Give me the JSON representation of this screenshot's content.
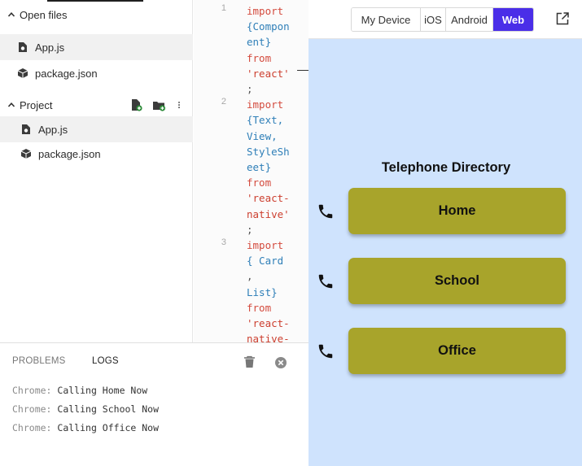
{
  "sidebar": {
    "open_files_label": "Open files",
    "open_files": [
      {
        "name": "App.js",
        "icon": "react-file-icon",
        "active": true
      },
      {
        "name": "package.json",
        "icon": "package-icon",
        "active": false
      }
    ],
    "project_label": "Project",
    "project_files": [
      {
        "name": "App.js",
        "icon": "react-file-icon",
        "active": true
      },
      {
        "name": "package.json",
        "icon": "package-icon",
        "active": false
      }
    ],
    "project_actions": [
      "new-file-icon",
      "new-folder-icon",
      "more-vertical-icon"
    ]
  },
  "editor": {
    "line_numbers": [
      "1",
      "2",
      "3"
    ],
    "lines": [
      {
        "text": "import",
        "cls": "kw"
      },
      {
        "text": "{Compon",
        "cls": "id"
      },
      {
        "text": "ent}",
        "cls": "id"
      },
      {
        "text": "from",
        "cls": "kw"
      },
      {
        "text": "'react'",
        "cls": "str"
      },
      {
        "text": ";",
        "cls": "pn"
      },
      {
        "text": "import",
        "cls": "kw"
      },
      {
        "text": "{Text,",
        "cls": "id"
      },
      {
        "text": "View,",
        "cls": "id"
      },
      {
        "text": "StyleSh",
        "cls": "id"
      },
      {
        "text": "eet}",
        "cls": "id"
      },
      {
        "text": "from",
        "cls": "kw"
      },
      {
        "text": "'react-",
        "cls": "str"
      },
      {
        "text": "native'",
        "cls": "str"
      },
      {
        "text": ";",
        "cls": "pn"
      },
      {
        "text": "import",
        "cls": "kw"
      },
      {
        "text": "{ Card",
        "cls": "id"
      },
      {
        "text": ",",
        "cls": "pn"
      },
      {
        "text": "List}",
        "cls": "id"
      },
      {
        "text": "from",
        "cls": "kw"
      },
      {
        "text": "'react-",
        "cls": "str"
      },
      {
        "text": "native-",
        "cls": "str"
      }
    ]
  },
  "panel": {
    "tab_problems": "PROBLEMS",
    "tab_logs": "LOGS",
    "logs": [
      {
        "source": "Chrome:",
        "message": "Calling Home Now"
      },
      {
        "source": "Chrome:",
        "message": "Calling School Now"
      },
      {
        "source": "Chrome:",
        "message": "Calling Office Now"
      }
    ]
  },
  "preview": {
    "platforms": [
      "My Device",
      "iOS",
      "Android",
      "Web"
    ],
    "selected_platform": "Web",
    "title": "Telephone Directory",
    "contacts": [
      "Home",
      "School",
      "Office"
    ]
  },
  "colors": {
    "preview_bg": "#cfe3fd",
    "button_bg": "#a8a42b",
    "selected_tab": "#4a2ee8"
  }
}
